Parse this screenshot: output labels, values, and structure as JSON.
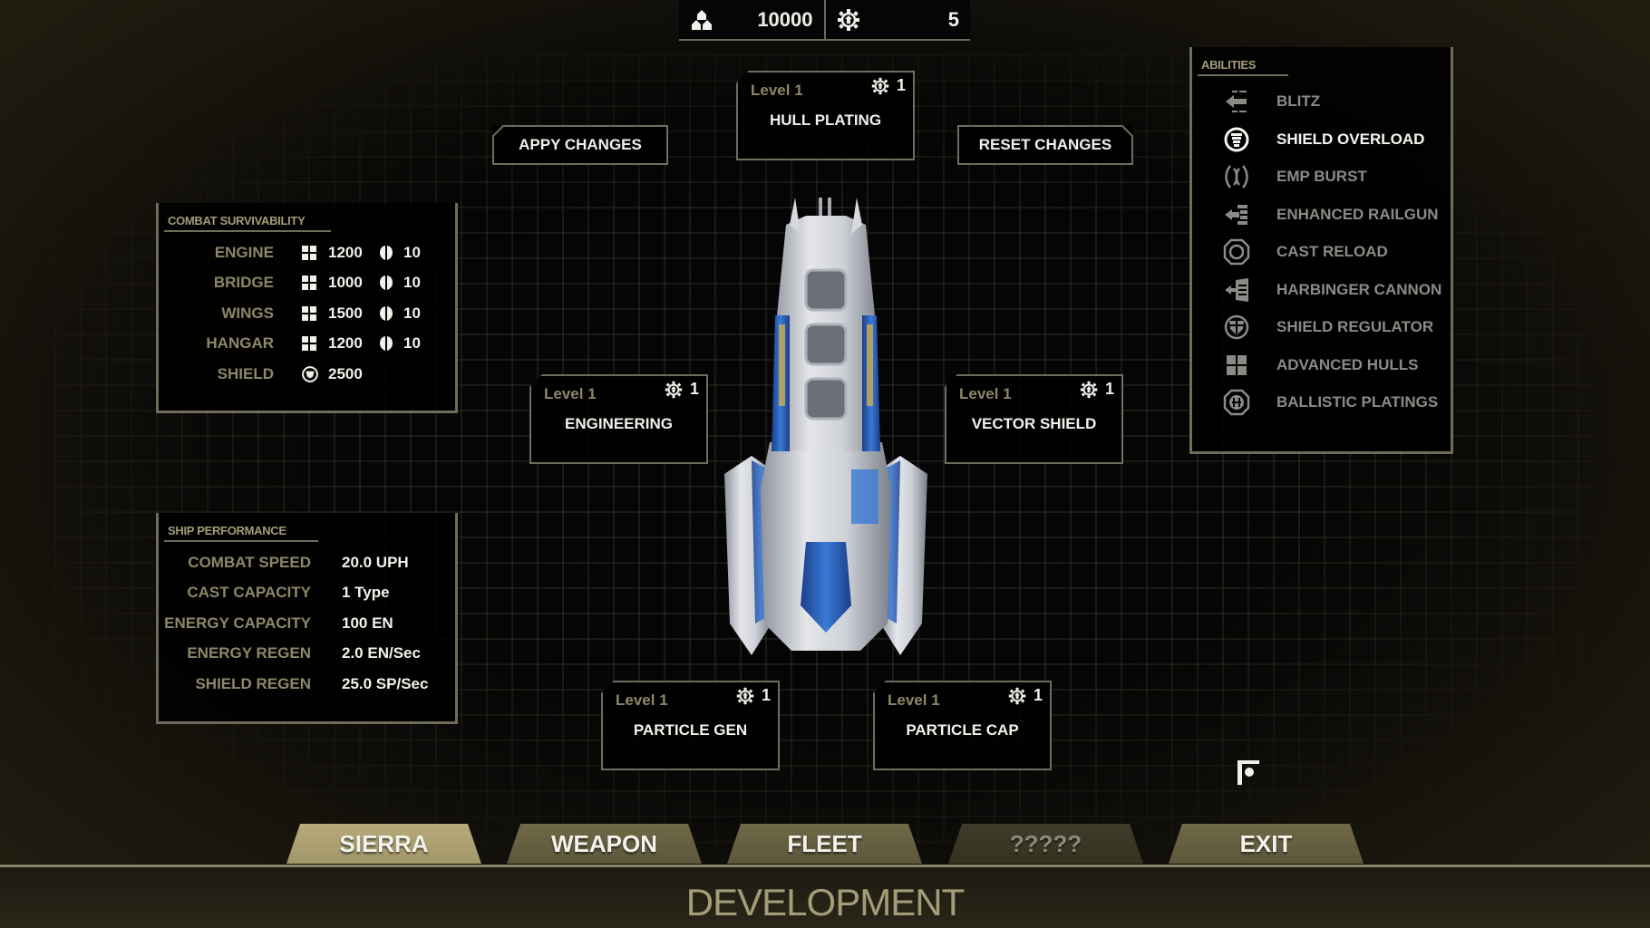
{
  "resources": {
    "credits": {
      "icon": "crystals-icon",
      "value": "10000"
    },
    "tech_points": {
      "icon": "gear-upgrade-icon",
      "value": "5"
    }
  },
  "actions": {
    "apply_label": "APPY CHANGES",
    "reset_label": "RESET CHANGES"
  },
  "modules": [
    {
      "id": "hull-plating",
      "level": "Level 1",
      "cost": "1",
      "name": "HULL PLATING"
    },
    {
      "id": "engineering",
      "level": "Level 1",
      "cost": "1",
      "name": "ENGINEERING"
    },
    {
      "id": "vector-shield",
      "level": "Level 1",
      "cost": "1",
      "name": "VECTOR SHIELD"
    },
    {
      "id": "particle-gen",
      "level": "Level 1",
      "cost": "1",
      "name": "PARTICLE GEN"
    },
    {
      "id": "particle-cap",
      "level": "Level 1",
      "cost": "1",
      "name": "PARTICLE CAP"
    }
  ],
  "combat_survivability": {
    "title": "COMBAT SURVIVABILITY",
    "rows": [
      {
        "label": "ENGINE",
        "hull": "1200",
        "armor": "10"
      },
      {
        "label": "BRIDGE",
        "hull": "1000",
        "armor": "10"
      },
      {
        "label": "WINGS",
        "hull": "1500",
        "armor": "10"
      },
      {
        "label": "HANGAR",
        "hull": "1200",
        "armor": "10"
      }
    ],
    "shield": {
      "label": "SHIELD",
      "value": "2500"
    }
  },
  "ship_performance": {
    "title": "SHIP PERFORMANCE",
    "rows": [
      {
        "label": "COMBAT SPEED",
        "value": "20.0 UPH"
      },
      {
        "label": "CAST CAPACITY",
        "value": "1 Type"
      },
      {
        "label": "ENERGY CAPACITY",
        "value": "100 EN"
      },
      {
        "label": "ENERGY REGEN",
        "value": "2.0 EN/Sec"
      },
      {
        "label": "SHIELD REGEN",
        "value": "25.0 SP/Sec"
      }
    ]
  },
  "abilities": {
    "title": "ABILITIES",
    "items": [
      {
        "label": "BLITZ",
        "icon": "blitz-icon",
        "active": false
      },
      {
        "label": "SHIELD OVERLOAD",
        "icon": "shield-overload-icon",
        "active": true
      },
      {
        "label": "EMP BURST",
        "icon": "emp-burst-icon",
        "active": false
      },
      {
        "label": "ENHANCED RAILGUN",
        "icon": "railgun-icon",
        "active": false
      },
      {
        "label": "CAST RELOAD",
        "icon": "cast-reload-icon",
        "active": false
      },
      {
        "label": "HARBINGER CANNON",
        "icon": "harbinger-cannon-icon",
        "active": false
      },
      {
        "label": "SHIELD REGULATOR",
        "icon": "shield-regulator-icon",
        "active": false
      },
      {
        "label": "ADVANCED HULLS",
        "icon": "advanced-hulls-icon",
        "active": false
      },
      {
        "label": "BALLISTIC PLATINGS",
        "icon": "ballistic-platings-icon",
        "active": false
      }
    ]
  },
  "tabs": [
    {
      "label": "SIERRA",
      "state": "active"
    },
    {
      "label": "WEAPON",
      "state": "normal"
    },
    {
      "label": "FLEET",
      "state": "normal"
    },
    {
      "label": "?????",
      "state": "locked"
    },
    {
      "label": "EXIT",
      "state": "normal"
    }
  ],
  "screen_title": "DEVELOPMENT",
  "colors": {
    "accent_gold": "#a49c77",
    "label_tan": "#8d8769",
    "border": "#6f6c5a",
    "ship_blue": "#2a5cb0"
  }
}
